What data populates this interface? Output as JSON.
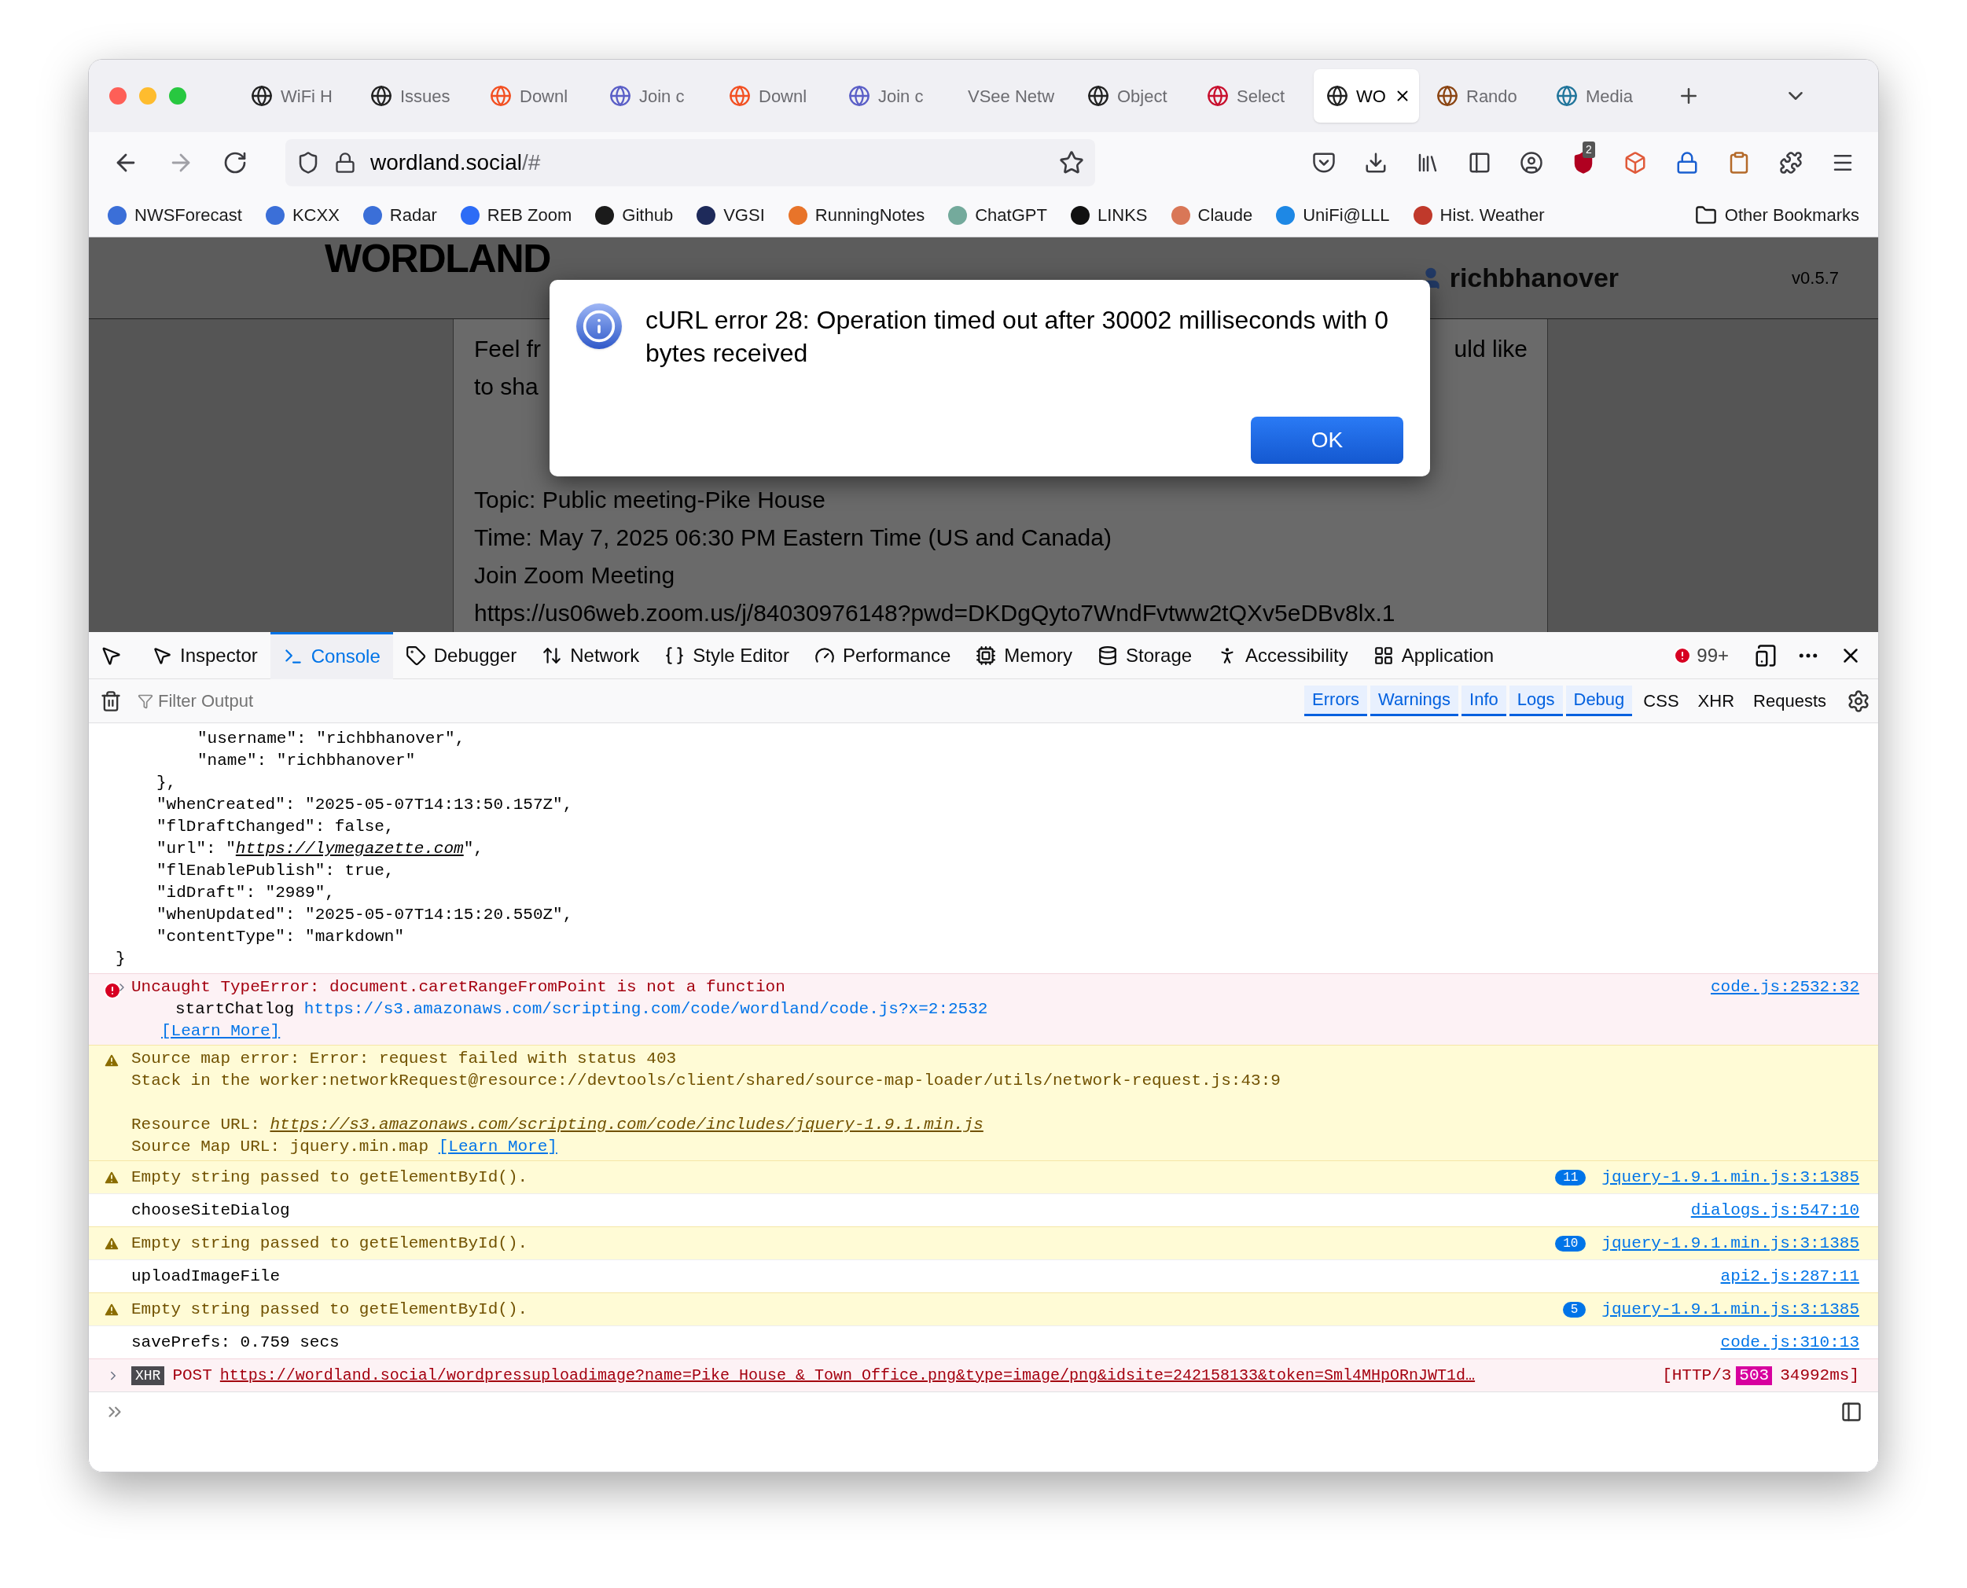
{
  "tabs": [
    {
      "label": "WiFi H",
      "selected": false
    },
    {
      "label": "Issues",
      "selected": false
    },
    {
      "label": "Downl",
      "selected": false
    },
    {
      "label": "Join c",
      "selected": false
    },
    {
      "label": "Downl",
      "selected": false
    },
    {
      "label": "Join c",
      "selected": false
    },
    {
      "label": "VSee Netw",
      "selected": false
    },
    {
      "label": "Object",
      "selected": false
    },
    {
      "label": "Select",
      "selected": false
    },
    {
      "label": "WO",
      "selected": true
    },
    {
      "label": "Rando",
      "selected": false
    },
    {
      "label": "Media",
      "selected": false
    }
  ],
  "address_bar": {
    "host": "wordland.social",
    "path": "/#"
  },
  "extension_badge": "2",
  "bookmarks": [
    {
      "label": "NWSForecast",
      "color": "#3b6fd8"
    },
    {
      "label": "KCXX",
      "color": "#3b6fd8"
    },
    {
      "label": "Radar",
      "color": "#3b6fd8"
    },
    {
      "label": "REB Zoom",
      "color": "#2d6cf6"
    },
    {
      "label": "Github",
      "color": "#1b1b1b"
    },
    {
      "label": "VGSI",
      "color": "#1e2a5a"
    },
    {
      "label": "RunningNotes",
      "color": "#e8742a"
    },
    {
      "label": "ChatGPT",
      "color": "#74aa9c"
    },
    {
      "label": "LINKS",
      "color": "#111111"
    },
    {
      "label": "Claude",
      "color": "#d97757"
    },
    {
      "label": "UniFi@LLL",
      "color": "#1e88e5"
    },
    {
      "label": "Hist. Weather",
      "color": "#c0392b"
    }
  ],
  "other_bookmarks": "Other Bookmarks",
  "page": {
    "logo": "WORDLAND",
    "user": "richbhanover",
    "version": "v0.5.7",
    "fragments": [
      "Feel fr",
      "uld like",
      "to sha"
    ],
    "lines": [
      "Topic: Public meeting-Pike House",
      "Time: May 7, 2025 06:30 PM Eastern Time (US and Canada)",
      "Join Zoom Meeting",
      "https://us06web.zoom.us/j/84030976148?pwd=DKDgQyto7WndFvtww2tQXv5eDBv8lx.1"
    ]
  },
  "dialog": {
    "message": "cURL error 28: Operation timed out after 30002 milliseconds with 0 bytes received",
    "button": "OK"
  },
  "devtools": {
    "tabs": [
      {
        "label": "Inspector",
        "selected": false
      },
      {
        "label": "Console",
        "selected": true
      },
      {
        "label": "Debugger",
        "selected": false
      },
      {
        "label": "Network",
        "selected": false
      },
      {
        "label": "Style Editor",
        "selected": false
      },
      {
        "label": "Performance",
        "selected": false
      },
      {
        "label": "Memory",
        "selected": false
      },
      {
        "label": "Storage",
        "selected": false
      },
      {
        "label": "Accessibility",
        "selected": false
      },
      {
        "label": "Application",
        "selected": false
      }
    ],
    "error_count": "99+",
    "filter_placeholder": "Filter Output",
    "filters": [
      {
        "label": "Errors",
        "selected": true
      },
      {
        "label": "Warnings",
        "selected": true
      },
      {
        "label": "Info",
        "selected": true
      },
      {
        "label": "Logs",
        "selected": true
      },
      {
        "label": "Debug",
        "selected": true
      },
      {
        "label": "CSS",
        "selected": false
      },
      {
        "label": "XHR",
        "selected": false
      },
      {
        "label": "Requests",
        "selected": false
      }
    ]
  },
  "console": {
    "json_tree": [
      {
        "children": [
          {
            "children": [
              {
                "text": "\"username\": \"richbhanover\","
              },
              {
                "text": "\"name\": \"richbhanover\""
              }
            ]
          },
          {
            "text": "},"
          },
          {
            "text": "\"whenCreated\": \"2025-05-07T14:13:50.157Z\","
          },
          {
            "text": "\"flDraftChanged\": false,"
          },
          {
            "text": "\"url\": \"",
            "link": "https://lymegazette.com",
            "after": "\","
          },
          {
            "text": "\"flEnablePublish\": true,"
          },
          {
            "text": "\"idDraft\": \"2989\","
          },
          {
            "text": "\"whenUpdated\": \"2025-05-07T14:15:20.550Z\","
          },
          {
            "text": "\"contentType\": \"markdown\""
          }
        ]
      },
      {
        "text": "}"
      }
    ],
    "messages": [
      {
        "kind": "error",
        "text": "Uncaught TypeError: document.caretRangeFromPoint is not a function",
        "stack_fn": "startChatlog",
        "stack_url": "https://s3.amazonaws.com/scripting.com/code/wordland/code.js?x=2:2532",
        "learn_more": "[Learn More]",
        "source": "code.js:2532:32"
      },
      {
        "kind": "sourcemap",
        "text": "Source map error: Error: request failed with status 403",
        "stack": "Stack in the worker:networkRequest@resource://devtools/client/shared/source-map-loader/utils/network-request.js:43:9",
        "resource_label": "Resource URL: ",
        "resource_url": "https://s3.amazonaws.com/scripting.com/code/includes/jquery-1.9.1.min.js",
        "map_label": "Source Map URL: jquery.min.map",
        "learn_more": "[Learn More]"
      },
      {
        "kind": "warning",
        "text": "Empty string passed to getElementById().",
        "count": "11",
        "source": "jquery-1.9.1.min.js:3:1385"
      },
      {
        "kind": "log",
        "text": "chooseSiteDialog",
        "source": "dialogs.js:547:10"
      },
      {
        "kind": "warning",
        "text": "Empty string passed to getElementById().",
        "count": "10",
        "source": "jquery-1.9.1.min.js:3:1385"
      },
      {
        "kind": "log",
        "text": "uploadImageFile",
        "source": "api2.js:287:11"
      },
      {
        "kind": "warning",
        "text": "Empty string passed to getElementById().",
        "count": "5",
        "source": "jquery-1.9.1.min.js:3:1385"
      },
      {
        "kind": "log",
        "text": "savePrefs: 0.759 secs",
        "source": "code.js:310:13"
      },
      {
        "kind": "xhr",
        "tag": "XHR",
        "method": "POST",
        "url": "https://wordland.social/wordpressuploadimage?name=Pike House & Town Office.png&type=image/png&idsite=242158133&token=Sml4MHpORnJWT1d…",
        "status_before": "[HTTP/3",
        "status": "503",
        "status_after": "34992ms]"
      }
    ]
  }
}
